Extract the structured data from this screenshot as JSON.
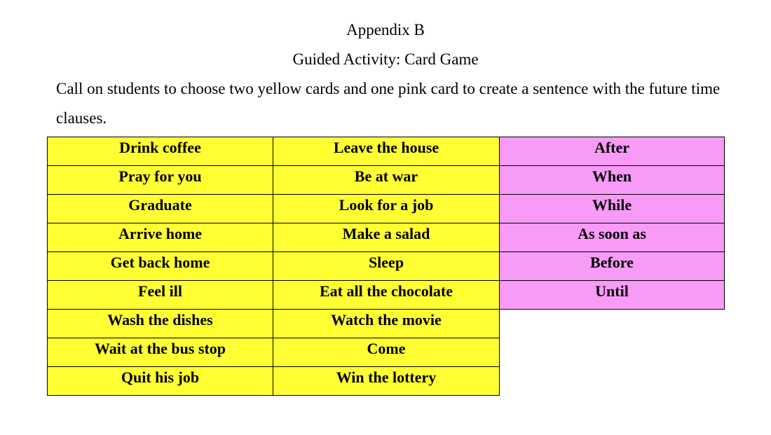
{
  "document": {
    "title": "Appendix B",
    "subtitle": "Guided Activity: Card Game",
    "instructions": "Call on students to choose two yellow cards and one pink card to create a sentence with the future time clauses."
  },
  "colors": {
    "yellow_card": "#ffff33",
    "pink_card": "#f79bf7"
  },
  "cards": {
    "yellow_col1": [
      "Drink coffee",
      "Pray for you",
      "Graduate",
      "Arrive home",
      "Get back home",
      "Feel ill",
      "Wash the dishes",
      "Wait at the bus stop",
      "Quit his job"
    ],
    "yellow_col2": [
      "Leave the house",
      "Be at war",
      "Look for a job",
      "Make a salad",
      "Sleep",
      "Eat all the chocolate",
      "Watch the movie",
      "Come",
      "Win the lottery"
    ],
    "pink_col": [
      "After",
      "When",
      "While",
      "As soon as",
      "Before",
      "Until"
    ]
  }
}
